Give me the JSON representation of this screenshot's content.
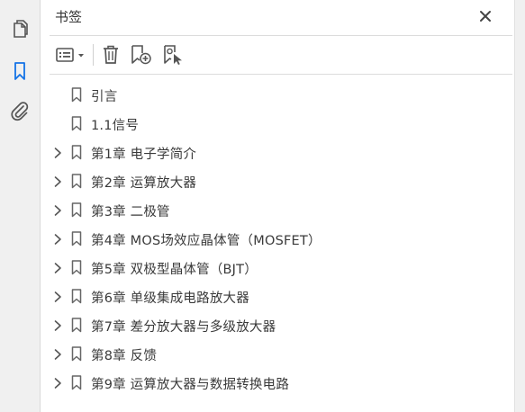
{
  "panel": {
    "title": "书签"
  },
  "left_rail": {
    "items": [
      {
        "name": "pages-icon",
        "active": false
      },
      {
        "name": "bookmark-icon",
        "active": true
      },
      {
        "name": "attachment-icon",
        "active": false
      }
    ],
    "active_color": "#1473e6"
  },
  "toolbar": {
    "buttons": [
      "options-menu-icon",
      "delete-icon",
      "new-bookmark-icon",
      "new-bookmark-from-structure-icon"
    ]
  },
  "bookmarks": [
    {
      "label": "引言",
      "expandable": false
    },
    {
      "label": "1.1信号",
      "expandable": false
    },
    {
      "label": "第1章  电子学简介",
      "expandable": true
    },
    {
      "label": "第2章  运算放大器",
      "expandable": true
    },
    {
      "label": "第3章  二极管",
      "expandable": true
    },
    {
      "label": "第4章  MOS场效应晶体管（MOSFET）",
      "expandable": true
    },
    {
      "label": "第5章  双极型晶体管（BJT）",
      "expandable": true
    },
    {
      "label": "第6章  单级集成电路放大器",
      "expandable": true
    },
    {
      "label": "第7章  差分放大器与多级放大器",
      "expandable": true
    },
    {
      "label": "第8章  反馈",
      "expandable": true
    },
    {
      "label": "第9章  运算放大器与数据转换电路",
      "expandable": true
    }
  ]
}
